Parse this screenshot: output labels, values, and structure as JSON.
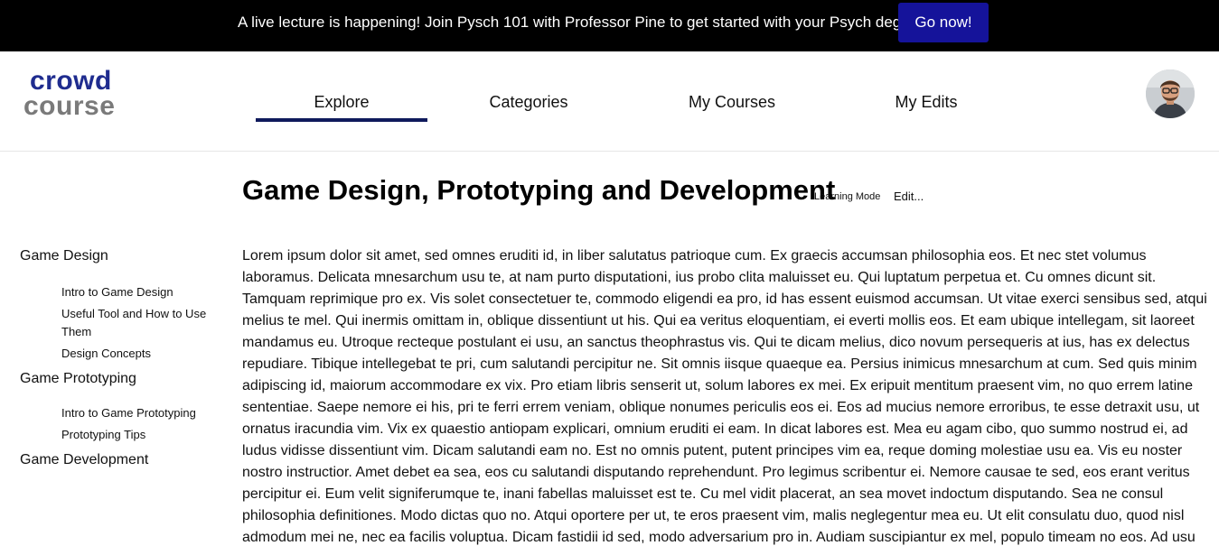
{
  "banner": {
    "message": "A live lecture is happening! Join Pysch 101 with Professor Pine to get started with your Psych degree!",
    "button_label": "Go now!"
  },
  "logo": {
    "line1": "crowd",
    "line2": "course"
  },
  "nav": {
    "tabs": [
      {
        "label": "Explore",
        "active": true
      },
      {
        "label": "Categories",
        "active": false
      },
      {
        "label": "My Courses",
        "active": false
      },
      {
        "label": "My Edits",
        "active": false
      }
    ]
  },
  "header": {
    "avatar_icon": "user-avatar-photo"
  },
  "course": {
    "title": "Game Design, Prototyping and Development",
    "mode_label": "Learning Mode",
    "edit_label": "Edit..."
  },
  "sidebar": {
    "sections": [
      {
        "title": "Game Design",
        "items": [
          "Intro to Game Design",
          "Useful Tool and How to Use Them",
          "Design Concepts"
        ]
      },
      {
        "title": "Game Prototyping",
        "items": [
          "Intro to Game Prototyping",
          "Prototyping Tips"
        ]
      },
      {
        "title": "Game Development",
        "items": []
      }
    ]
  },
  "content": {
    "body": "Lorem ipsum dolor sit amet, sed omnes eruditi id, in liber salutatus patrioque cum. Ex graecis accumsan philosophia eos. Et nec stet volumus laboramus. Delicata mnesarchum usu te, at nam purto disputationi, ius probo clita maluisset eu. Qui luptatum perpetua et. Cu omnes dicunt sit. Tamquam reprimique pro ex. Vis solet consectetuer te, commodo eligendi ea pro, id has essent euismod accumsan. Ut vitae exerci sensibus sed, atqui melius te mel. Qui inermis omittam in, oblique dissentiunt ut his. Qui ea veritus eloquentiam, ei everti mollis eos. Et eam ubique intellegam, sit laoreet mandamus eu. Utroque recteque postulant ei usu, an sanctus theophrastus vis. Qui te dicam melius, dico novum persequeris at ius, has ex delectus repudiare. Tibique intellegebat te pri, cum salutandi percipitur ne. Sit omnis iisque quaeque ea. Persius inimicus mnesarchum at cum. Sed quis minim adipiscing id, maiorum accommodare ex vix. Pro etiam libris senserit ut, solum labores ex mei. Ex eripuit mentitum praesent vim, no quo errem latine sententiae. Saepe nemore ei his, pri te ferri errem veniam, oblique nonumes periculis eos ei. Eos ad mucius nemore erroribus, te esse detraxit usu, ut ornatus iracundia vim. Vix ex quaestio antiopam explicari, omnium eruditi ei eam. In dicat labores est. Mea eu agam cibo, quo summo nostrud ei, ad ludus vidisse dissentiunt vim. Dicam salutandi eam no. Est no omnis putent, putent principes vim ea, reque doming molestiae usu ea. Vis eu noster nostro instructior. Amet debet ea sea, eos cu salutandi disputando reprehendunt. Pro legimus scribentur ei. Nemore causae te sed, eos erant veritus percipitur ei. Eum velit signiferumque te, inani fabellas maluisset est te. Cu mel vidit placerat, an sea movet indoctum disputando. Sea ne consul philosophia definitiones. Modo dictas quo no. Atqui oportere per ut, te eros praesent vim, malis neglegentur mea eu. Ut elit consulatu duo, quod nisl admodum mei ne, nec ea facilis voluptua. Dicam fastidii id sed, modo adversarium pro in. Audiam suscipiantur ex mel, populo timeam no eos. Ad usu"
  },
  "colors": {
    "banner_bg": "#000000",
    "button_bg": "#15139a",
    "logo_primary": "#1f2c8f",
    "logo_secondary": "#7a7a7a",
    "active_tab_underline": "#0f1a5c"
  }
}
